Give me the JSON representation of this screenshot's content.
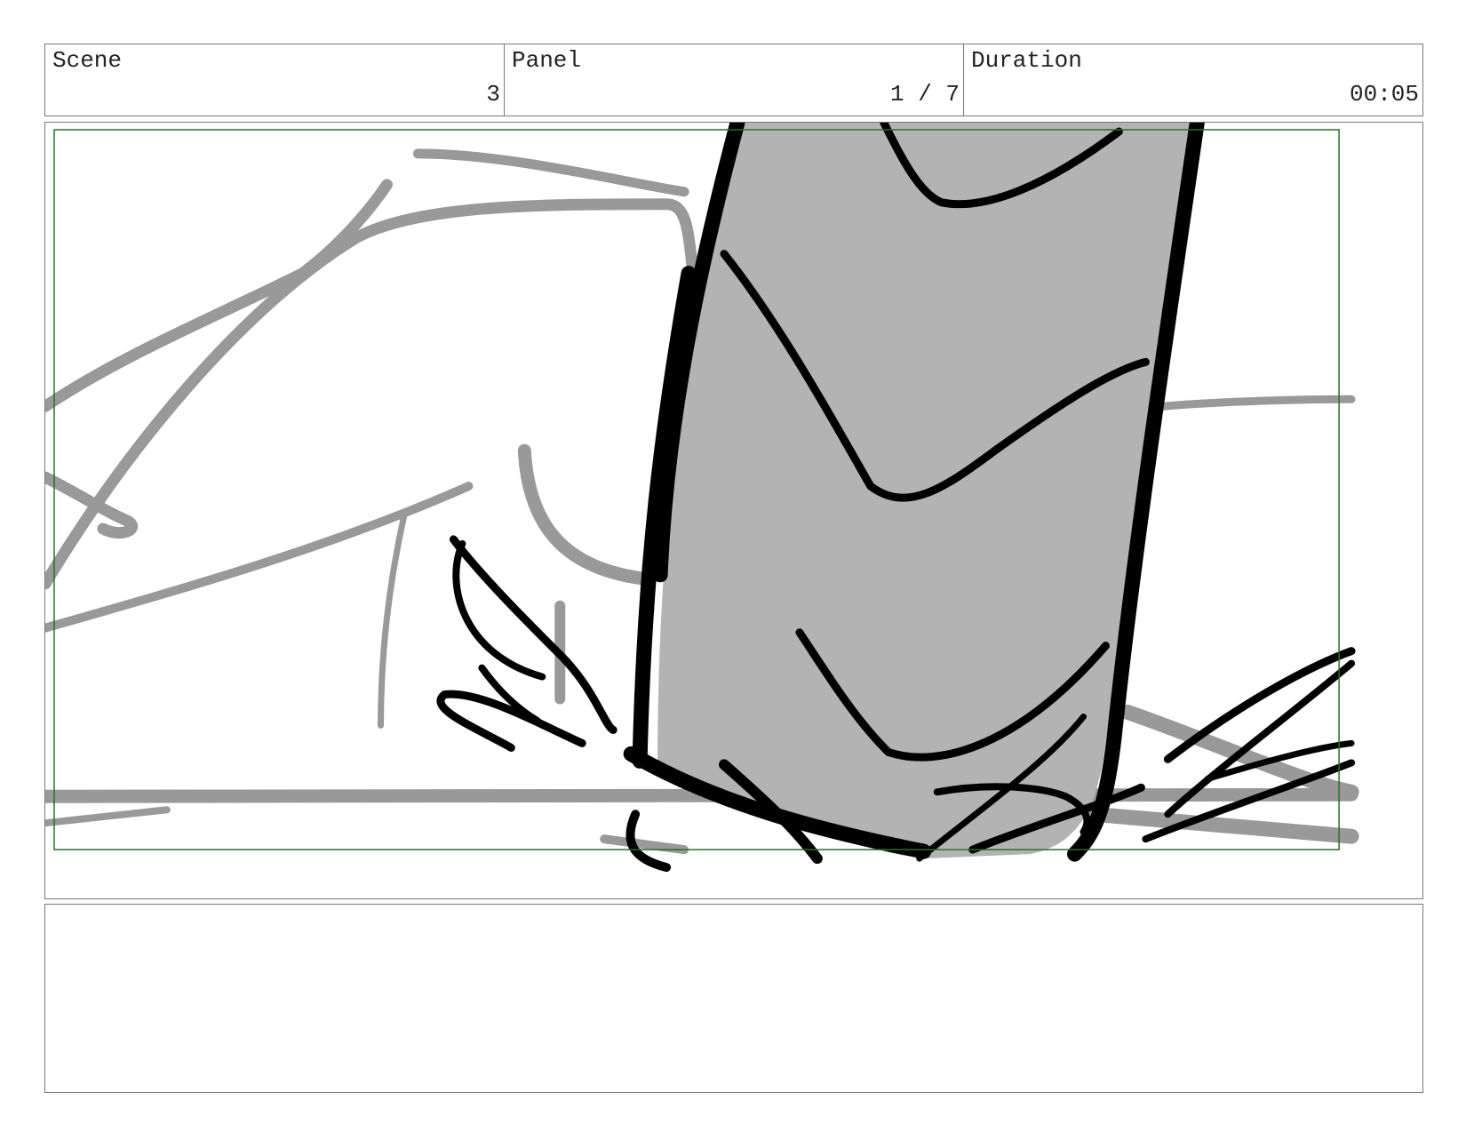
{
  "header": {
    "scene": {
      "label": "Scene",
      "value": "3"
    },
    "panel": {
      "label": "Panel",
      "value": "1 / 7"
    },
    "duration": {
      "label": "Duration",
      "value": "00:05"
    }
  },
  "frame": {
    "sketch_line_color": "#000000",
    "background_sketch_color": "#999999",
    "fill_color": "#b3b3b3",
    "safe_area_color": "#2e6b2e"
  },
  "notes": {
    "text": ""
  }
}
